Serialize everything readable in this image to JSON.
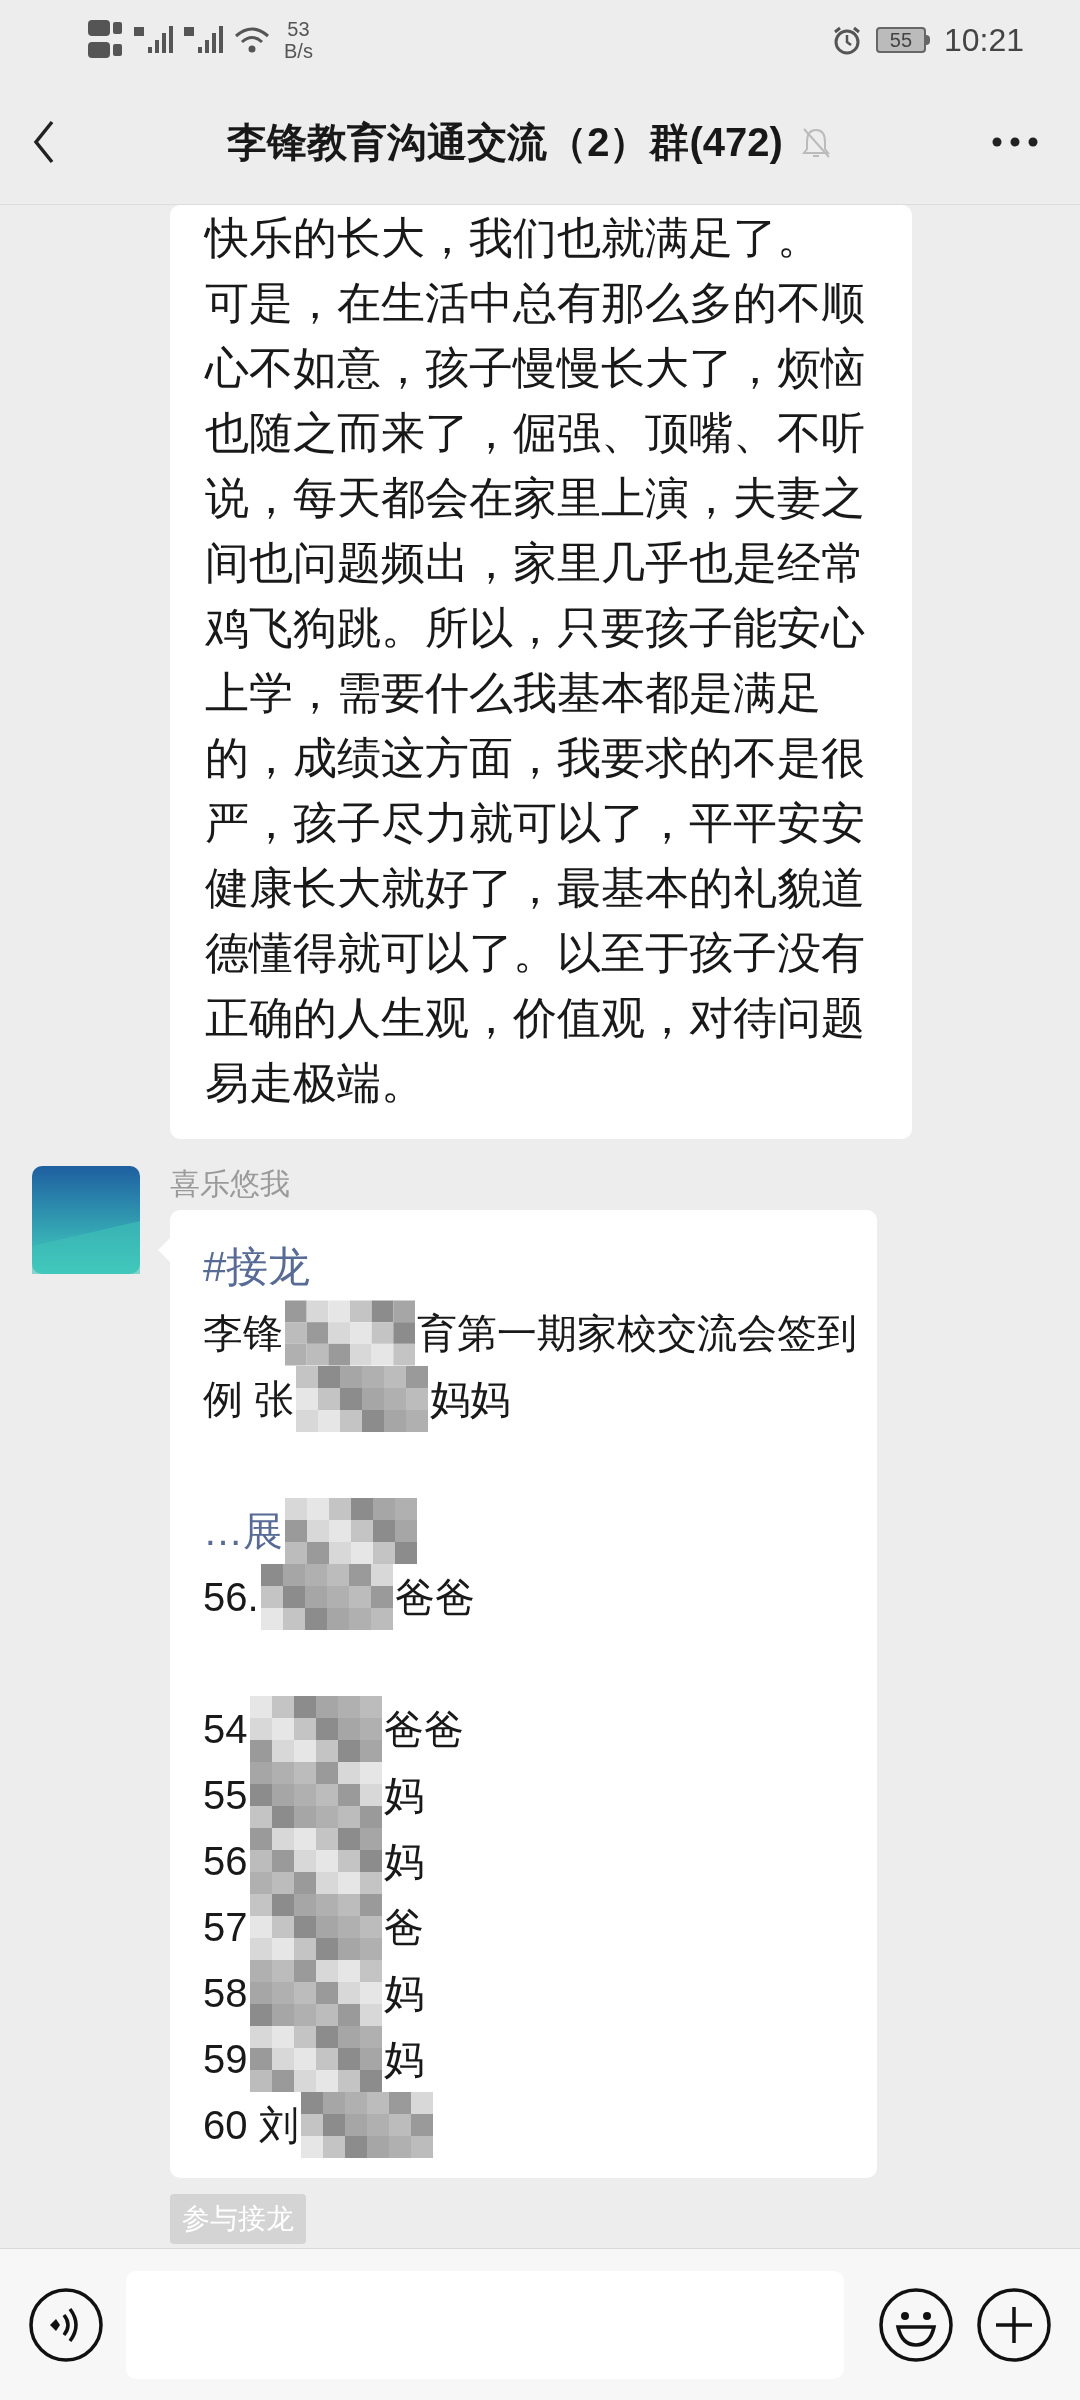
{
  "status_bar": {
    "network_speed_value": "53",
    "network_speed_unit": "B/s",
    "battery": "55",
    "time": "10:21"
  },
  "header": {
    "title": "李锋教育沟通交流（2）群(472)",
    "muted": true
  },
  "messages": [
    {
      "kind": "text",
      "lines": [
        "快乐的长大，我们也就满足了。",
        "可是，在生活中总有那么多的不顺",
        "心不如意，孩子慢慢长大了，烦恼",
        "也随之而来了，倔强、顶嘴、不听",
        "说，每天都会在家里上演，夫妻之",
        "间也问题频出，家里几乎也是经常",
        "鸡飞狗跳。所以，只要孩子能安心",
        "上学，需要什么我基本都是满足",
        "的，成绩这方面，我要求的不是很",
        "严，孩子尽力就可以了，平平安安",
        "健康长大就好了，最基本的礼貌道",
        "德懂得就可以了。以至于孩子没有",
        "正确的人生观，价值观，对待问题",
        "易走极端。"
      ]
    },
    {
      "kind": "solitaire",
      "sender": "喜乐悠我",
      "tag": "#接龙",
      "rows": [
        {
          "kind": "plain",
          "before": "李锋",
          "blurred": true,
          "after": "育第一期家校交流会签到"
        },
        {
          "kind": "plain",
          "before": "例 张",
          "blurred": true,
          "after": "妈妈"
        },
        {
          "kind": "gap"
        },
        {
          "kind": "link",
          "before": "…展",
          "blurred": true
        },
        {
          "kind": "plain",
          "before": "56.",
          "blurred": true,
          "after": "爸爸"
        },
        {
          "kind": "gap"
        },
        {
          "kind": "plain",
          "before": "54",
          "blurred": true,
          "after": "爸爸"
        },
        {
          "kind": "plain",
          "before": "55",
          "blurred": true,
          "after": "妈"
        },
        {
          "kind": "plain",
          "before": "56",
          "blurred": true,
          "after": "妈"
        },
        {
          "kind": "plain",
          "before": "57",
          "blurred": true,
          "after": "爸"
        },
        {
          "kind": "plain",
          "before": "58",
          "blurred": true,
          "after": "妈"
        },
        {
          "kind": "plain",
          "before": "59",
          "blurred": true,
          "after": "妈"
        },
        {
          "kind": "plain",
          "before": "60 刘",
          "blurred": true
        }
      ],
      "join_button": "参与接龙"
    }
  ]
}
